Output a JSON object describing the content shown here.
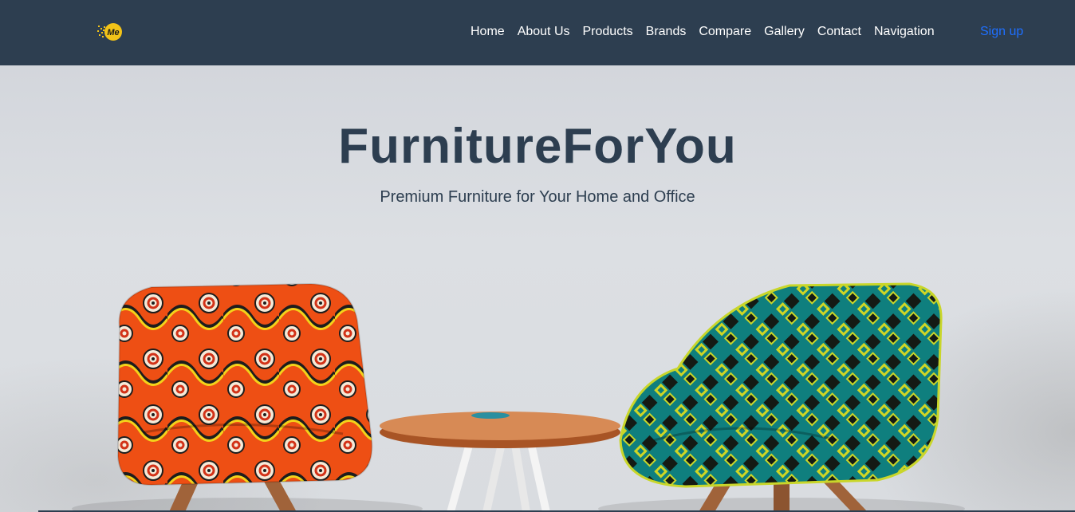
{
  "navbar": {
    "logo_text": "Me",
    "links": [
      {
        "label": "Home"
      },
      {
        "label": "About Us"
      },
      {
        "label": "Products"
      },
      {
        "label": "Brands"
      },
      {
        "label": "Compare"
      },
      {
        "label": "Gallery"
      },
      {
        "label": "Contact"
      },
      {
        "label": "Navigation"
      }
    ],
    "signup_label": "Sign up"
  },
  "hero": {
    "title": "FurnitureForYou",
    "subtitle": "Premium Furniture for Your Home and Office"
  },
  "colors": {
    "navbar_bg": "#2d3e50",
    "accent_link": "#1e6fff",
    "logo_yellow": "#f2c318"
  },
  "icons": [
    "logo-icon"
  ]
}
